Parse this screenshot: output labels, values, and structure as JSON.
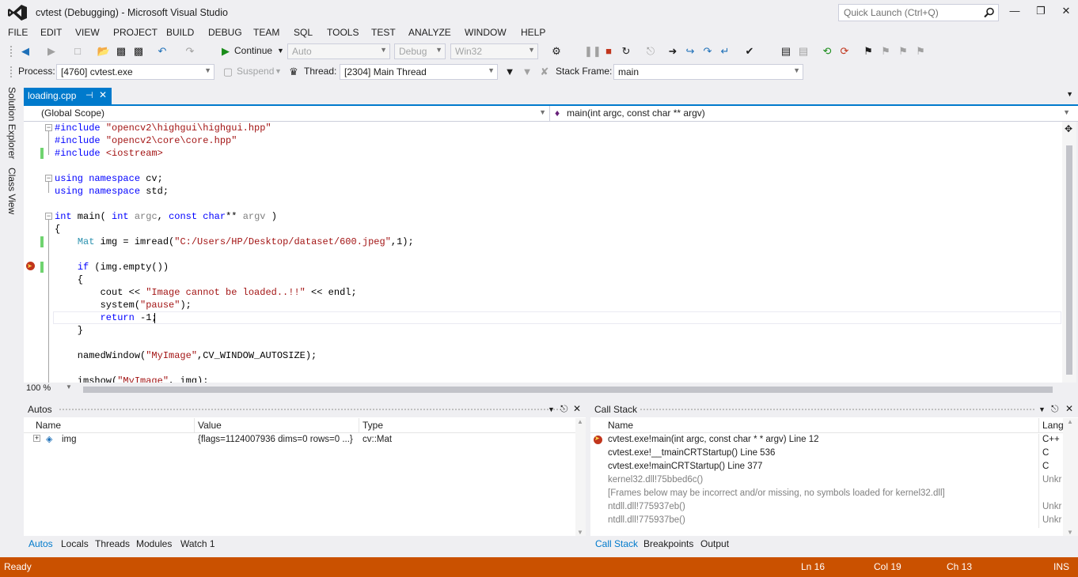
{
  "window": {
    "title": "cvtest (Debugging) - Microsoft Visual Studio",
    "quick_launch_placeholder": "Quick Launch (Ctrl+Q)"
  },
  "menu": [
    "FILE",
    "EDIT",
    "VIEW",
    "PROJECT",
    "BUILD",
    "DEBUG",
    "TEAM",
    "SQL",
    "TOOLS",
    "TEST",
    "ANALYZE",
    "WINDOW",
    "HELP"
  ],
  "toolbar": {
    "continue_label": "Continue",
    "solution_config": "Auto",
    "build_config": "Debug",
    "platform": "Win32"
  },
  "debug_location": {
    "process_label": "Process:",
    "process_value": "[4760] cvtest.exe",
    "suspend_label": "Suspend",
    "thread_label": "Thread:",
    "thread_value": "[2304] Main Thread",
    "stack_frame_label": "Stack Frame:",
    "stack_frame_value": "main"
  },
  "side_tabs": [
    "Solution Explorer",
    "Class View"
  ],
  "document_tab": {
    "name": "loading.cpp",
    "pin": "⊣",
    "close": "✕"
  },
  "navigation": {
    "scope": "(Global Scope)",
    "member": "main(int argc, const char ** argv)"
  },
  "code_lines": [
    "#include \"opencv2\\highgui\\highgui.hpp\"",
    "#include \"opencv2\\core\\core.hpp\"",
    "#include <iostream>",
    "",
    "using namespace cv;",
    "using namespace std;",
    "",
    "int main( int argc, const char** argv )",
    "{",
    "    Mat img = imread(\"C:/Users/HP/Desktop/dataset/600.jpeg\",1);",
    "",
    "    if (img.empty())",
    "    {",
    "        cout << \"Image cannot be loaded..!!\" << endl;",
    "        system(\"pause\");",
    "        return -1;",
    "    }",
    "",
    "    namedWindow(\"MyImage\",CV_WINDOW_AUTOSIZE);",
    "",
    "    imshow(\"MyImage\", img);"
  ],
  "editor": {
    "zoom": "100 %"
  },
  "autos": {
    "title": "Autos",
    "columns": [
      "Name",
      "Value",
      "Type"
    ],
    "rows": [
      {
        "name": "img",
        "value": "{flags=1124007936 dims=0 rows=0 ...}",
        "type": "cv::Mat"
      }
    ],
    "tabs": [
      "Autos",
      "Locals",
      "Threads",
      "Modules",
      "Watch 1"
    ]
  },
  "call_stack": {
    "title": "Call Stack",
    "columns": [
      "Name",
      "Lang"
    ],
    "rows": [
      {
        "name": "cvtest.exe!main(int argc, const char * * argv) Line 12",
        "lang": "C++",
        "current": true,
        "grey": false
      },
      {
        "name": "cvtest.exe!__tmainCRTStartup() Line 536",
        "lang": "C",
        "current": false,
        "grey": false
      },
      {
        "name": "cvtest.exe!mainCRTStartup() Line 377",
        "lang": "C",
        "current": false,
        "grey": false
      },
      {
        "name": "kernel32.dll!75bbed6c()",
        "lang": "Unkr",
        "current": false,
        "grey": true
      },
      {
        "name": "[Frames below may be incorrect and/or missing, no symbols loaded for kernel32.dll]",
        "lang": "",
        "current": false,
        "grey": true
      },
      {
        "name": "ntdll.dll!775937eb()",
        "lang": "Unkr",
        "current": false,
        "grey": true
      },
      {
        "name": "ntdll.dll!775937be()",
        "lang": "Unkr",
        "current": false,
        "grey": true
      }
    ],
    "tabs": [
      "Call Stack",
      "Breakpoints",
      "Output"
    ]
  },
  "status": {
    "text": "Ready",
    "line": "Ln 16",
    "col": "Col 19",
    "ch": "Ch 13",
    "mode": "INS"
  },
  "colors": {
    "accent": "#007ACC",
    "status_bar": "#CA5100",
    "breakpoint": "#C1351C",
    "change_bar": "#6FD36F"
  },
  "icons": {
    "vs_logo": "visual-studio-logo",
    "search": "search-icon",
    "continue": "play-icon",
    "stop": "stop-icon",
    "restart": "restart-icon",
    "pause": "pause-icon",
    "breakpoint": "breakpoint-arrow-icon"
  }
}
